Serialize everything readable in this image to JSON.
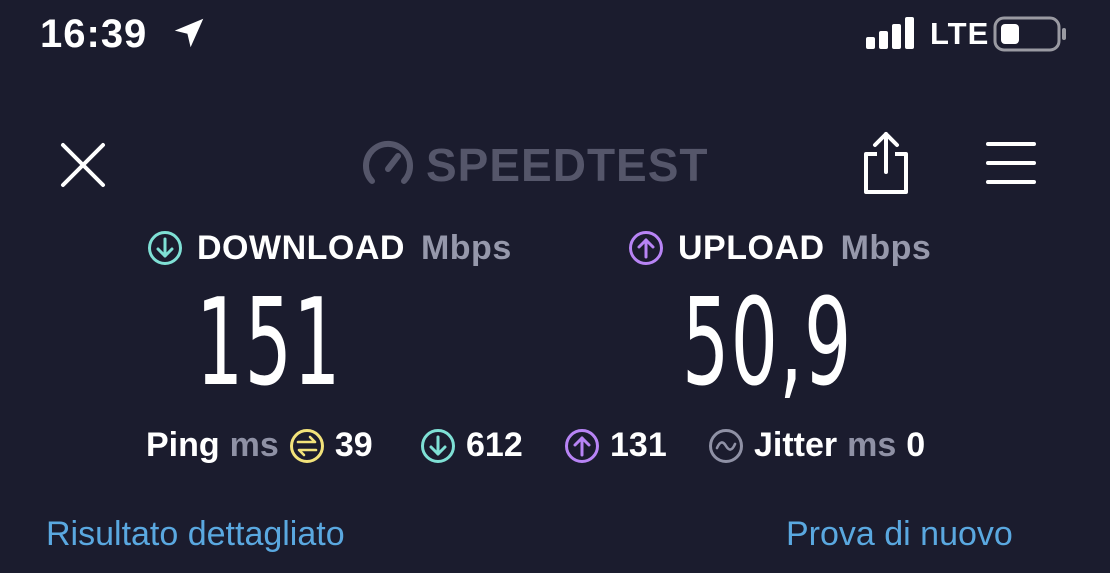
{
  "status_bar": {
    "time": "16:39",
    "network": "LTE",
    "icons": [
      "location-arrow-icon",
      "signal-bars-icon",
      "battery-icon"
    ]
  },
  "header": {
    "logo_text": "SPEEDTEST",
    "icons": [
      "close-icon",
      "speedometer-icon",
      "share-icon",
      "hamburger-menu-icon"
    ]
  },
  "download": {
    "label": "DOWNLOAD",
    "unit": "Mbps",
    "value": "151",
    "color": "#7fe0d5"
  },
  "upload": {
    "label": "UPLOAD",
    "unit": "Mbps",
    "value": "50,9",
    "color": "#b884f5"
  },
  "ping": {
    "label": "Ping",
    "unit": "ms",
    "idle": "39",
    "download": "612",
    "upload": "131",
    "idle_color": "#f2e27a"
  },
  "jitter": {
    "label": "Jitter",
    "unit": "ms",
    "value": "0"
  },
  "links": {
    "detailed": "Risultato dettagliato",
    "retry": "Prova di nuovo",
    "color": "#5aa8e0"
  },
  "colors": {
    "background": "#1b1c2e",
    "muted_text": "#9698ab",
    "logo": "#55566a"
  }
}
